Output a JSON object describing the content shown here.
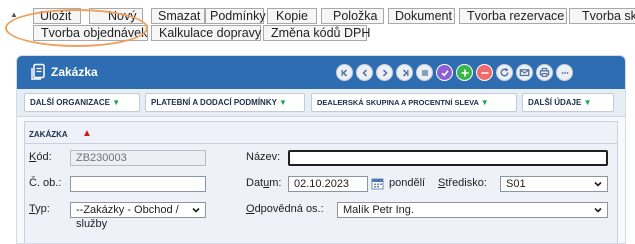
{
  "toolbar": {
    "row1": [
      "Uložit",
      "Nový",
      "Smazat",
      "Podmínky",
      "Kopie",
      "Položka",
      "Dokument",
      "Tvorba rezervace",
      "Tvorba skla"
    ],
    "row2": [
      "Tvorba objednávek",
      "Kalkulace dopravy",
      "Změna kódů DPH"
    ]
  },
  "panel": {
    "title": "Zakázka"
  },
  "tabs": [
    "DALŠÍ ORGANIZACE",
    "PLATEBNÍ A DODACÍ PODMÍNKY",
    "DEALERSKÁ SKUPINA A PROCENTNÍ SLEVA",
    "DALŠÍ ÚDAJE"
  ],
  "section": {
    "title": "ZAKÁZKA"
  },
  "form": {
    "kod_label_u": "K",
    "kod_label_rest": "ód:",
    "kod_value": "ZB230003",
    "nazev_label": "Název:",
    "nazev_value": "",
    "cob_label": "Č. ob.:",
    "cob_value": "",
    "datum_label_a": "Dat",
    "datum_label_u": "u",
    "datum_label_b": "m:",
    "datum_value": "02.10.2023",
    "weekday": "pondělí",
    "stredisko_label_u": "S",
    "stredisko_label_rest": "tředisko:",
    "stredisko_value": "S01",
    "typ_label_u": "T",
    "typ_label_rest": "yp:",
    "typ_value": "--Zakázky - Obchod / služby",
    "odpovedna_label_u": "O",
    "odpovedna_label_rest": "dpovědná os.:",
    "odpovedna_value": "Malík Petr Ing."
  },
  "colors": {
    "header": "#2f6db3",
    "highlight": "#f0a05a",
    "tab_triangle": "#1fa34a",
    "collapse_triangle": "#d11a1a"
  }
}
